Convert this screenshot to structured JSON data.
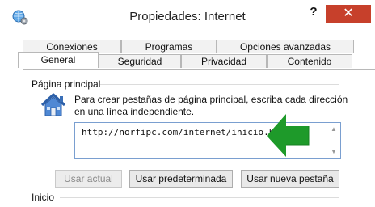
{
  "window": {
    "title": "Propiedades: Internet",
    "help_label": "?",
    "close_label": "✕"
  },
  "tabs": {
    "row_top": [
      "Conexiones",
      "Programas",
      "Opciones avanzadas"
    ],
    "row_bottom": [
      "General",
      "Seguridad",
      "Privacidad",
      "Contenido"
    ],
    "active": "General"
  },
  "home_group": {
    "label": "Página principal",
    "description_line1": "Para crear pestañas de página principal, escriba cada dirección",
    "description_line2": "en una línea independiente.",
    "url_value": "http://norfipc.com/internet/inicio.html",
    "buttons": {
      "use_current": "Usar actual",
      "use_default": "Usar predeterminada",
      "use_new_tab": "Usar nueva pestaña"
    }
  },
  "startup_group": {
    "label": "Inicio"
  },
  "colors": {
    "close_button": "#c7402b",
    "arrow_green": "#1e9a2a",
    "input_border": "#7a9fd0"
  },
  "icons": [
    "internet-options-icon",
    "home-icon",
    "green-arrow-icon"
  ]
}
